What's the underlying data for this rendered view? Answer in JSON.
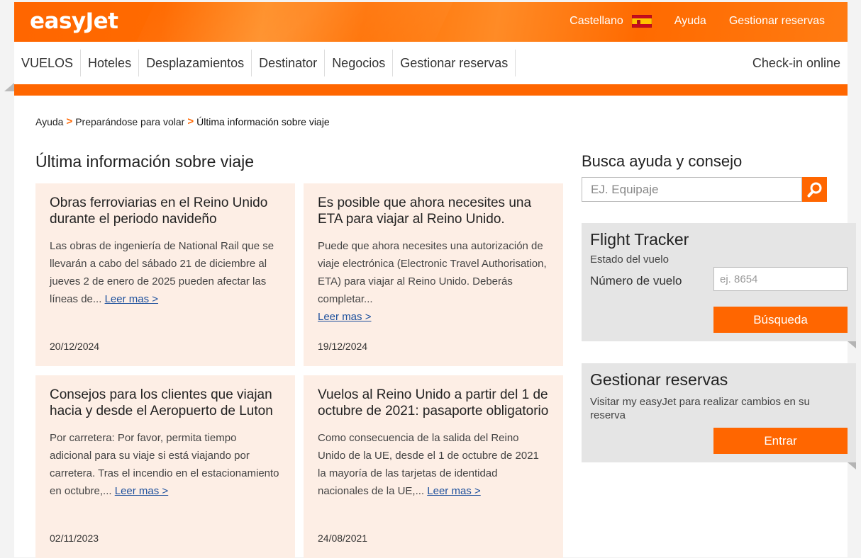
{
  "header": {
    "logo": "easyJet",
    "language": "Castellano",
    "help": "Ayuda",
    "manage": "Gestionar reservas"
  },
  "nav": {
    "items": [
      "VUELOS",
      "Hoteles",
      "Desplazamientos",
      "Destinator",
      "Negocios",
      "Gestionar reservas"
    ],
    "checkin": "Check-in online"
  },
  "breadcrumb": {
    "items": [
      "Ayuda",
      "Preparándose para volar"
    ],
    "current": "Última información sobre viaje",
    "separator": ">"
  },
  "main": {
    "title": "Última información sobre viaje",
    "more_label": "Leer mas >",
    "cards": [
      {
        "title": "Obras ferroviarias en el Reino Unido durante el periodo navideño",
        "body": "Las obras de ingeniería de National Rail que se llevarán a cabo del sábado 21 de diciembre al jueves 2 de enero de 2025 pueden afectar las líneas de...",
        "date": "20/12/2024"
      },
      {
        "title": "Es posible que ahora necesites una ETA para viajar al Reino Unido.",
        "body": "Puede que ahora necesites una autorización de viaje electrónica (Electronic Travel Authorisation, ETA) para viajar al Reino Unido. Deberás completar...",
        "date": "19/12/2024"
      },
      {
        "title": "Consejos para los clientes que viajan hacia y desde el Aeropuerto de Luton",
        "body": "Por carretera:  Por favor, permita tiempo adicional para su viaje si está viajando por carretera. Tras el incendio en el estacionamiento en octubre,...",
        "date": "02/11/2023"
      },
      {
        "title": "Vuelos al Reino Unido a partir del 1 de octubre de 2021: pasaporte obligatorio",
        "body": "Como consecuencia de la salida del Reino Unido de la UE, desde el 1 de octubre de 2021 la mayoría de las tarjetas de identidad nacionales de la UE,...",
        "date": "24/08/2021"
      }
    ]
  },
  "sidebar": {
    "search_title": "Busca ayuda y consejo",
    "search_placeholder": "EJ. Equipaje",
    "tracker": {
      "title": "Flight Tracker",
      "subtitle": "Estado del vuelo",
      "label": "Número de vuelo",
      "placeholder": "ej. 8654",
      "button": "Búsqueda"
    },
    "manage": {
      "title": "Gestionar reservas",
      "text": "Visitar my easyJet para realizar cambios en su reserva",
      "button": "Entrar"
    }
  },
  "colors": {
    "brand": "#ff6600",
    "card_bg": "#fdeee5",
    "panel_bg": "#e5e5e5",
    "link": "#1c4f9c"
  },
  "icons": {
    "search": "magnifier-icon",
    "flag": "spain-flag-icon"
  }
}
